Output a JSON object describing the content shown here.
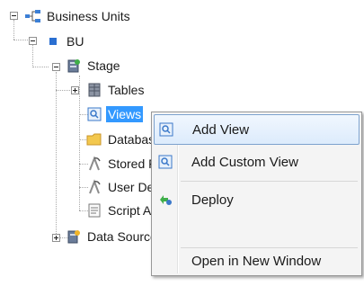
{
  "tree": {
    "root": {
      "label": "Business Units",
      "icon": "hierarchy-icon"
    },
    "bu": {
      "label": "BU",
      "icon": "blue-square-icon"
    },
    "stage": {
      "label": "Stage",
      "icon": "stage-icon"
    },
    "children": [
      {
        "label": "Tables",
        "icon": "tables-icon"
      },
      {
        "label": "Views",
        "icon": "view-icon"
      },
      {
        "label": "Databas",
        "icon": "folder-icon"
      },
      {
        "label": "Stored F",
        "icon": "stored-procedure-icon"
      },
      {
        "label": "User De",
        "icon": "user-defined-icon"
      },
      {
        "label": "Script A",
        "icon": "script-icon"
      }
    ],
    "data_sources": {
      "label": "Data Source",
      "icon": "data-source-icon"
    }
  },
  "context_menu": {
    "items": [
      {
        "label": "Add View",
        "icon": "view-icon"
      },
      {
        "label": "Add Custom View",
        "icon": "view-icon"
      },
      {
        "label": "Deploy",
        "icon": "deploy-icon"
      },
      {
        "label": ""
      },
      {
        "label": "Open in New Window"
      }
    ]
  }
}
